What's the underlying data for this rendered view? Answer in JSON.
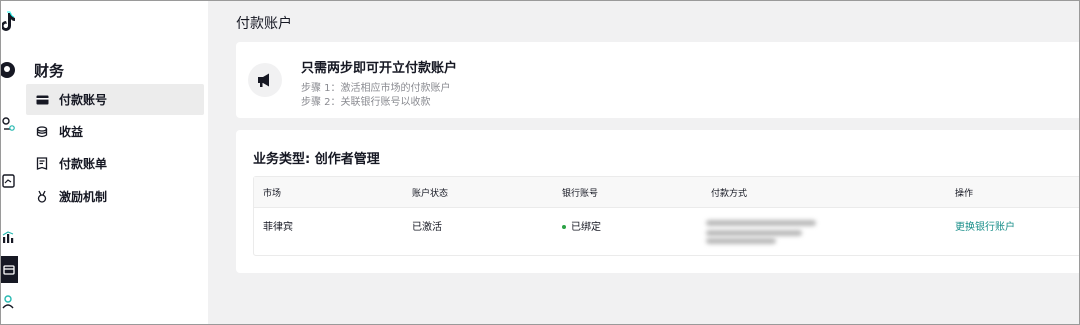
{
  "rail": {
    "icons": [
      "tiktok-logo-icon",
      "profile-icon",
      "creator-tools-icon",
      "inbox-icon",
      "analytics-icon",
      "wallet-icon",
      "community-icon"
    ]
  },
  "sidebar": {
    "section_title": "财务",
    "items": [
      {
        "label": "付款账号",
        "icon": "card-icon",
        "active": true
      },
      {
        "label": "收益",
        "icon": "coins-icon",
        "active": false
      },
      {
        "label": "付款账单",
        "icon": "receipt-icon",
        "active": false
      },
      {
        "label": "激励机制",
        "icon": "medal-icon",
        "active": false
      }
    ]
  },
  "main": {
    "page_title": "付款账户",
    "intro": {
      "title": "只需两步即可开立付款账户",
      "steps": [
        "步骤 1：激活相应市场的付款账户",
        "步骤 2：关联银行账号以收款"
      ],
      "icon": "megaphone-icon"
    },
    "business": {
      "title": "业务类型: 创作者管理",
      "columns": [
        "市场",
        "账户状态",
        "银行账号",
        "付款方式",
        "操作"
      ],
      "rows": [
        {
          "market": "菲律宾",
          "account_status": "已激活",
          "bank_account": "已绑定",
          "payment_method": "",
          "action": "更换银行账户"
        }
      ]
    }
  },
  "colors": {
    "accent_link": "#1a8f8a",
    "status_green": "#2ba245",
    "active_nav_bg": "#ececec",
    "page_bg": "#f1f1f2"
  }
}
